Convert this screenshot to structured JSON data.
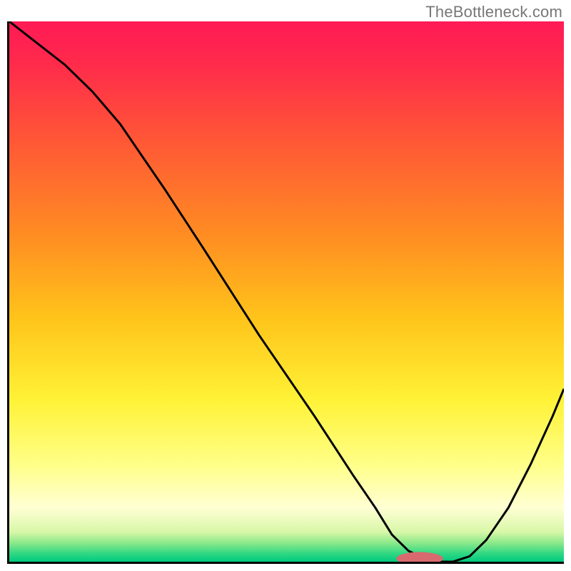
{
  "watermark": "TheBottleneck.com",
  "chart_data": {
    "type": "line",
    "title": "",
    "xlabel": "",
    "ylabel": "",
    "xlim": [
      0,
      100
    ],
    "ylim": [
      0,
      100
    ],
    "grid": false,
    "legend": false,
    "annotations": [],
    "background_gradient": {
      "stops": [
        {
          "offset": 0.0,
          "color": "#ff1a55"
        },
        {
          "offset": 0.08,
          "color": "#ff2b4b"
        },
        {
          "offset": 0.22,
          "color": "#ff5736"
        },
        {
          "offset": 0.4,
          "color": "#ff8e22"
        },
        {
          "offset": 0.55,
          "color": "#ffc41a"
        },
        {
          "offset": 0.7,
          "color": "#fff236"
        },
        {
          "offset": 0.82,
          "color": "#ffff88"
        },
        {
          "offset": 0.9,
          "color": "#ffffd4"
        },
        {
          "offset": 0.945,
          "color": "#d8f7a8"
        },
        {
          "offset": 0.965,
          "color": "#8ce98a"
        },
        {
          "offset": 0.985,
          "color": "#2fd884"
        },
        {
          "offset": 1.0,
          "color": "#00c97e"
        }
      ]
    },
    "series": [
      {
        "name": "bottleneck-curve",
        "color": "#000000",
        "x": [
          0,
          5,
          10,
          15,
          20,
          24,
          28,
          35,
          45,
          55,
          62,
          66,
          69,
          72,
          75,
          77,
          80,
          83,
          86,
          90,
          94,
          98,
          100
        ],
        "y": [
          100,
          96,
          92,
          87,
          81,
          75,
          69,
          58,
          42,
          27,
          16,
          10,
          5,
          2,
          0.5,
          0,
          0,
          1,
          4,
          10,
          18,
          27,
          32
        ]
      }
    ],
    "marker": {
      "name": "optimal-marker",
      "shape": "pill",
      "cx": 74,
      "cy": 0.6,
      "rx": 4.2,
      "ry": 1.2,
      "color": "#d86a6f"
    }
  }
}
